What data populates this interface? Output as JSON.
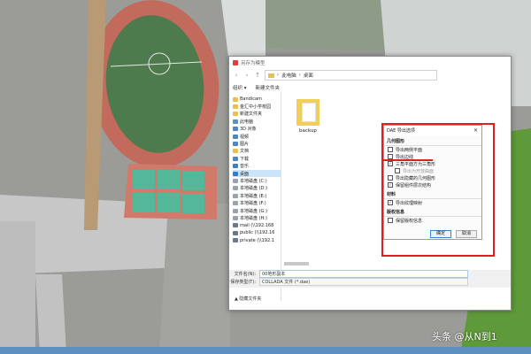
{
  "dialog": {
    "title": "另存为模型",
    "breadcrumb": [
      "此电脑",
      "桌面"
    ],
    "toolbar": {
      "organize": "组织 ▾",
      "new_folder": "新建文件夹"
    },
    "sidebar": [
      {
        "label": "Bandicam",
        "icon": "folder"
      },
      {
        "label": "金汇中小学校园",
        "icon": "folder"
      },
      {
        "label": "新建文件夹",
        "icon": "folder"
      },
      {
        "label": "此电脑",
        "icon": "pc"
      },
      {
        "label": "3D 对象",
        "icon": "media"
      },
      {
        "label": "视频",
        "icon": "media"
      },
      {
        "label": "图片",
        "icon": "media"
      },
      {
        "label": "文档",
        "icon": "folder"
      },
      {
        "label": "下载",
        "icon": "media"
      },
      {
        "label": "音乐",
        "icon": "music"
      },
      {
        "label": "桌面",
        "icon": "desk"
      },
      {
        "label": "本地磁盘 (C:)",
        "icon": "drive"
      },
      {
        "label": "本地磁盘 (D:)",
        "icon": "drive"
      },
      {
        "label": "本地磁盘 (E:)",
        "icon": "drive"
      },
      {
        "label": "本地磁盘 (F:)",
        "icon": "drive"
      },
      {
        "label": "本地磁盘 (G:)",
        "icon": "drive"
      },
      {
        "label": "本地磁盘 (H:)",
        "icon": "drive"
      },
      {
        "label": "mail (\\\\192.168",
        "icon": "net"
      },
      {
        "label": "public (\\\\192.16",
        "icon": "net"
      },
      {
        "label": "private (\\\\192.1",
        "icon": "net"
      }
    ],
    "selected_sidebar_index": 10,
    "file": {
      "name": "backup"
    },
    "filename_label": "文件名(N):",
    "filename_value": "00地形副本",
    "filetype_label": "保存类型(T):",
    "filetype_value": "COLLADA 文件 (*.dae)",
    "hide_folders": "▲ 隐藏文件夹"
  },
  "options": {
    "title": "DAE 导出选项",
    "close": "✕",
    "groups": [
      {
        "heading": "几何图形",
        "items": [
          {
            "label": "导出两侧平面",
            "checked": false,
            "disabled": false
          },
          {
            "label": "导出边线",
            "checked": false,
            "disabled": false
          },
          {
            "label": "三角平面方为三角形",
            "checked": true,
            "disabled": false
          },
          {
            "label": "导出为开放曲面",
            "checked": false,
            "disabled": true
          },
          {
            "label": "导出隐藏的几何图形",
            "checked": false,
            "disabled": false
          },
          {
            "label": "保留组件层次结构",
            "checked": true,
            "disabled": false
          }
        ]
      },
      {
        "heading": "材料",
        "items": [
          {
            "label": "导出纹理映射",
            "checked": true,
            "disabled": false
          }
        ]
      },
      {
        "heading": "版权信息",
        "items": [
          {
            "label": "保留版权信息",
            "checked": false,
            "disabled": false
          }
        ]
      }
    ],
    "ok": "确定",
    "cancel": "取消"
  },
  "watermark": "头条 @从N到1",
  "colors": {
    "highlight": "#e02020",
    "ok_border": "#3b82d6"
  }
}
